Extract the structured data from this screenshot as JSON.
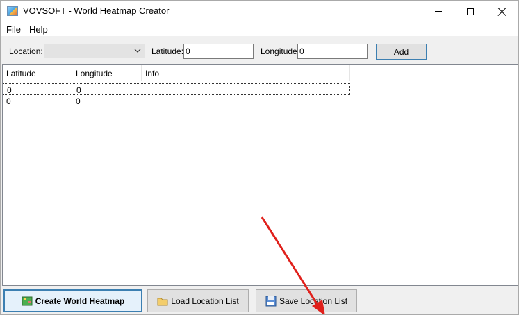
{
  "window": {
    "title": "VOVSOFT - World Heatmap Creator",
    "icon": "map-icon"
  },
  "menu": {
    "items": [
      {
        "label": "File"
      },
      {
        "label": "Help"
      }
    ]
  },
  "toolbar": {
    "location_label": "Location:",
    "location_value": "",
    "latitude_label": "Latitude:",
    "latitude_value": "0",
    "longitude_label": "Longitude:",
    "longitude_value": "0",
    "add_label": "Add"
  },
  "table": {
    "columns": [
      "Latitude",
      "Longitude",
      "Info"
    ],
    "rows": [
      {
        "latitude": "0",
        "longitude": "0",
        "info": "",
        "selected": true
      },
      {
        "latitude": "0",
        "longitude": "0",
        "info": "",
        "selected": false
      }
    ]
  },
  "actions": {
    "create_label": "Create World Heatmap",
    "load_label": "Load Location List",
    "save_label": "Save Location List"
  },
  "colors": {
    "accent_border": "#3c7fb1",
    "annotation_arrow": "#e0201b"
  }
}
